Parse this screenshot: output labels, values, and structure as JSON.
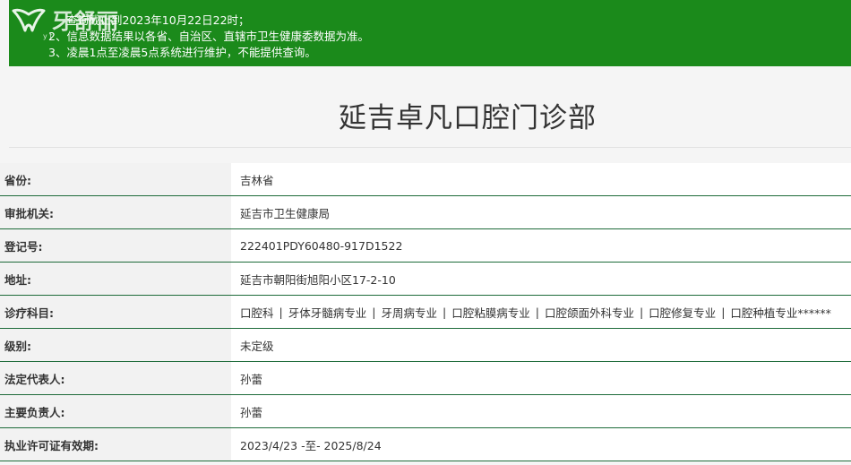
{
  "notice": {
    "line1": "查询截止到2023年10月22日22时；",
    "line2": "2、信息数据结果以各省、自治区、直辖市卫生健康委数据为准。",
    "line3": "3、凌晨1点至凌晨5点系统进行维护，不能提供查询。"
  },
  "watermark": {
    "text": "牙舒丽",
    "sub": "y  t"
  },
  "title": "延吉卓凡口腔门诊部",
  "info": {
    "province": {
      "label": "省份:",
      "value": "吉林省"
    },
    "authority": {
      "label": "审批机关:",
      "value": "延吉市卫生健康局"
    },
    "reg_no": {
      "label": "登记号:",
      "value": "222401PDY60480-917D1522"
    },
    "address": {
      "label": "地址:",
      "value": "延吉市朝阳街旭阳小区17-2-10"
    },
    "scope": {
      "label": "诊疗科目:",
      "separator": "|",
      "items": [
        "口腔科",
        "牙体牙髓病专业",
        "牙周病专业",
        "口腔粘膜病专业",
        "口腔颌面外科专业",
        "口腔修复专业",
        "口腔种植专业******"
      ]
    },
    "level": {
      "label": "级别:",
      "value": "未定级"
    },
    "legal_rep": {
      "label": "法定代表人:",
      "value": "孙蕾"
    },
    "principal": {
      "label": "主要负责人:",
      "value": "孙蕾"
    },
    "validity": {
      "label": "执业许可证有效期:",
      "value": "2023/4/23 -至- 2025/8/24"
    }
  }
}
